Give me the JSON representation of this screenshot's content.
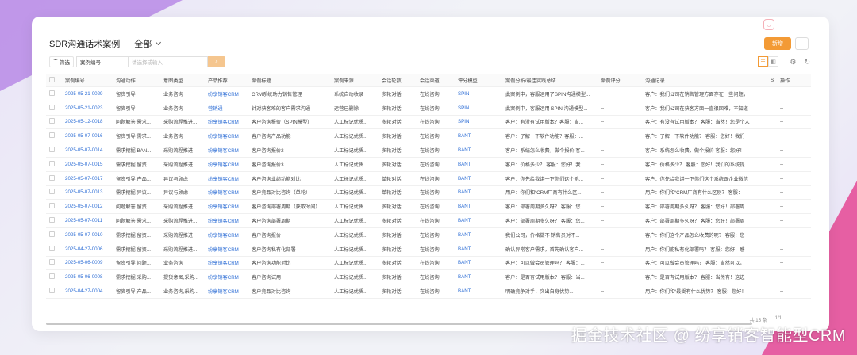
{
  "page": {
    "title": "SDR沟通话术案例",
    "view_label": "全部",
    "primary_button": "新增",
    "more_label": "···"
  },
  "toolbar": {
    "filter_label": "筛选",
    "field_label": "案例编号",
    "search_placeholder": "请选择或输入"
  },
  "table": {
    "columns": [
      "案例编号",
      "沟通动作",
      "意图类型",
      "产品推荐",
      "案例标题",
      "案例来源",
      "会话轮数",
      "会话渠道",
      "评分模型",
      "案例分析/最佳实践总结",
      "案例评分",
      "沟通记录",
      "S",
      "操作"
    ],
    "rows": [
      [
        "2025-05-21-0029",
        "留资引导",
        "业务咨询",
        "纷享销客CRM",
        "CRM系统助力销售管理",
        "系统自动收录",
        "多轮对话",
        "在线咨询",
        "SPIN",
        "此案例中，客服运用了SPIN沟通模型...",
        "--",
        "客户：我们公司在销售管理方面存在一些问题，"
      ],
      [
        "2025-05-21-0023",
        "留资引导",
        "业务咨询",
        "营销通",
        "针对获客难的客户需求沟通",
        "运营已删除",
        "多轮对话",
        "在线咨询",
        "SPIN",
        "此案例中，客服运用 SPIN 沟通模型...",
        "--",
        "客户：我们公司在获客方面一直很困难，不知道"
      ],
      [
        "2025-05-12-0018",
        "问题解答,需求...",
        "采购流程推进...",
        "纷享销客CRM",
        "客户咨询报价（SPIN模型）",
        "人工标记优质...",
        "多轮对话",
        "在线咨询",
        "SPIN",
        "客户：有没有试用版本？客服：当...",
        "--",
        "客户：有没有试用版本？ 客服：当然！您是个人"
      ],
      [
        "2025-05-07-0016",
        "留资引导,需求...",
        "业务咨询",
        "纷享销客CRM",
        "客户咨询产品功能",
        "人工标记优质...",
        "多轮对话",
        "在线咨询",
        "BANT",
        "客户：了解一下软件功能？客服：...",
        "--",
        "客户：了解一下软件功能？ 客服：您好！我们"
      ],
      [
        "2025-05-07-0014",
        "需求挖掘,BAN...",
        "采购流程推进",
        "纷享销客CRM",
        "客户咨询报价2",
        "人工标记优质...",
        "多轮对话",
        "在线咨询",
        "BANT",
        "客户：系统怎么收费，做个报价 客...",
        "--",
        "客户：系统怎么收费，做个报价 客服：您好！"
      ],
      [
        "2025-05-07-0015",
        "需求挖掘,留资...",
        "采购流程推进",
        "纷享销客CRM",
        "客户咨询报价3",
        "人工标记优质...",
        "多轮对话",
        "在线咨询",
        "BANT",
        "客户：价格多少？ 客服：您好！我...",
        "--",
        "客户：价格多少？ 客服：您好！我们的系统提"
      ],
      [
        "2025-05-07-0017",
        "留资引导,产品...",
        "异议与顾虑",
        "纷享销客CRM",
        "客户咨询业绩功能对比",
        "人工标记优质...",
        "单轮对话",
        "在线咨询",
        "BANT",
        "客户：你先给我讲一下你们这个系...",
        "--",
        "客户：你先给我讲一下你们这个系统跟企业微信"
      ],
      [
        "2025-05-07-0013",
        "需求挖掘,异议...",
        "异议与顾虑",
        "纷享销客CRM",
        "客户竞品对比咨询（单轮）",
        "人工标记优质...",
        "单轮对话",
        "在线咨询",
        "BANT",
        "用户：你们和“CRM厂商有什么区...",
        "--",
        "用户：你们和“CRM厂商有什么区别？ 客服："
      ],
      [
        "2025-05-07-0012",
        "问题解答,留资...",
        "采购流程推进",
        "纷享销客CRM",
        "客户咨询部署周期（获取时间）",
        "人工标记优质...",
        "多轮对话",
        "在线咨询",
        "BANT",
        "客户：部署周期多久呀？ 客服：您...",
        "--",
        "客户：部署周期多久呀？ 客服：您好！部署周"
      ],
      [
        "2025-05-07-0011",
        "问题解答,需求...",
        "采购流程推进...",
        "纷享销客CRM",
        "客户咨询部署周期",
        "人工标记优质...",
        "多轮对话",
        "在线咨询",
        "BANT",
        "客户：部署周期多久呀？ 客服：您...",
        "--",
        "客户：部署周期多久呀？ 客服：您好！部署周"
      ],
      [
        "2025-05-07-0010",
        "需求挖掘,留资...",
        "采购流程推进",
        "纷享销客CRM",
        "客户咨询报价",
        "人工标记优质...",
        "多轮对话",
        "在线咨询",
        "BANT",
        "我们公司，价格做不 销售员对不...",
        "--",
        "客户：你们这个产品怎么收费的呢？ 客服：您"
      ],
      [
        "2025-04-27-0006",
        "需求挖掘,留资...",
        "采购流程推进...",
        "纷享销客CRM",
        "客户咨询私有化部署",
        "人工标记优质...",
        "多轮对话",
        "在线咨询",
        "BANT",
        "确认异常客户需求，首先确认客户...",
        "--",
        "用户：你们能私有化部署吗？ 客服：您好！感"
      ],
      [
        "2025-05-06-0009",
        "留资引导,问题...",
        "业务咨询",
        "纷享销客CRM",
        "客户咨询功能对比",
        "人工标记优质...",
        "多轮对话",
        "在线咨询",
        "BANT",
        "客户：可以做会员管理吗？ 客服：...",
        "--",
        "客户：可以做会员管理吗？ 客服：当然可以，"
      ],
      [
        "2025-05-06-0008",
        "需求挖掘,采购...",
        "提货意图,采购...",
        "纷享销客CRM",
        "客户咨询试用",
        "人工标记优质...",
        "多轮对话",
        "在线咨询",
        "BANT",
        "客户：是否有试用版本？ 客服：当...",
        "--",
        "客户：是否有试用版本？ 客服：当然有！这边"
      ],
      [
        "2025-04-27-0004",
        "留资引导,产品...",
        "业务咨询,采购...",
        "纷享销客CRM",
        "客户竞品对比咨询",
        "人工标记优质...",
        "多轮对话",
        "在线咨询",
        "BANT",
        "明确竞争对手，突出自身优势...",
        "--",
        "用户：你们和“最受有什么优势？ 客服：您好！"
      ]
    ]
  },
  "pager": {
    "total": "共 15 条",
    "page": "1/1"
  },
  "watermark": "掘金技术社区 @ 纷享销客智能型CRM",
  "colors": {
    "accent": "#f39a35",
    "link": "#2f6fd6",
    "purple": "#b98ae6",
    "pink": "#e65fa3"
  }
}
